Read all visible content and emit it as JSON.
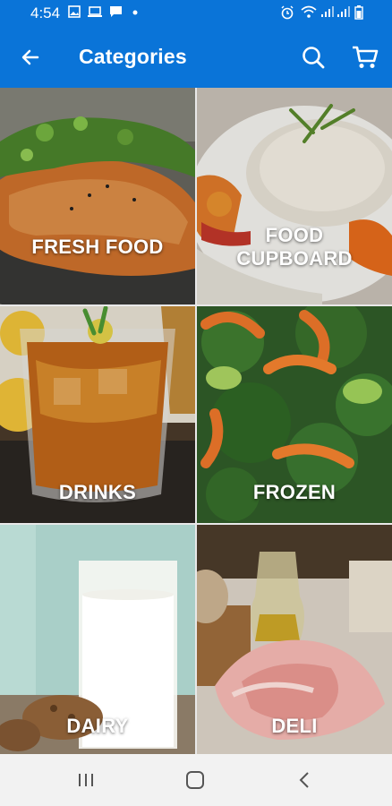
{
  "status_bar": {
    "time": "4:54"
  },
  "app_bar": {
    "title": "Categories"
  },
  "categories": [
    {
      "label": "FRESH FOOD"
    },
    {
      "label": "FOOD CUPBOARD"
    },
    {
      "label": "DRINKS"
    },
    {
      "label": "FROZEN"
    },
    {
      "label": "DAIRY"
    },
    {
      "label": "DELI"
    }
  ],
  "colors": {
    "primary": "#0a74d8",
    "label_text": "#ffffff",
    "nav_bar": "#f2f2f2"
  }
}
